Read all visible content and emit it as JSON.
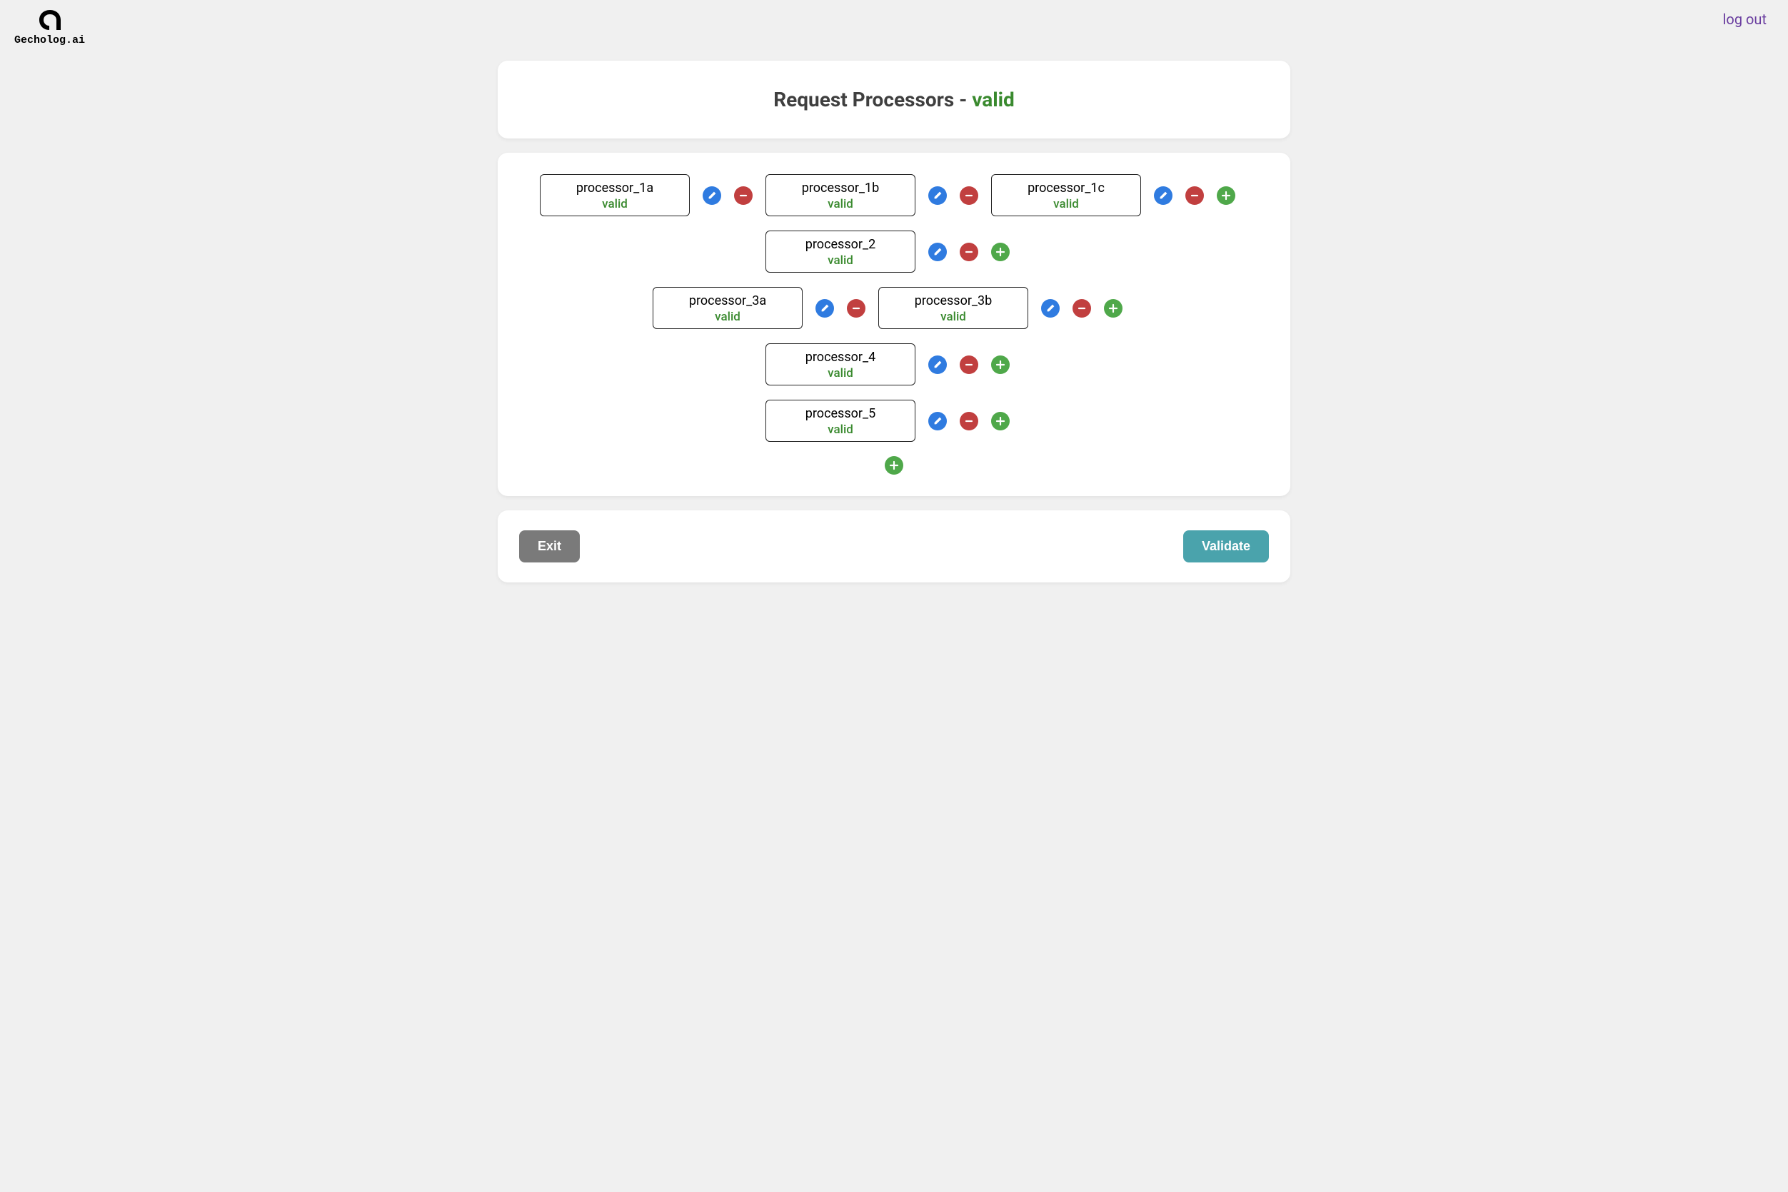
{
  "brand": "Gecholog.ai",
  "logout_label": "log out",
  "header": {
    "title": "Request Processors - ",
    "status": "valid"
  },
  "rows": [
    [
      {
        "name": "processor_1a",
        "status": "valid",
        "actions": [
          "edit",
          "remove"
        ]
      },
      {
        "name": "processor_1b",
        "status": "valid",
        "actions": [
          "edit",
          "remove"
        ]
      },
      {
        "name": "processor_1c",
        "status": "valid",
        "actions": [
          "edit",
          "remove",
          "add"
        ]
      }
    ],
    [
      {
        "name": "processor_2",
        "status": "valid",
        "actions": [
          "edit",
          "remove",
          "add"
        ]
      }
    ],
    [
      {
        "name": "processor_3a",
        "status": "valid",
        "actions": [
          "edit",
          "remove"
        ]
      },
      {
        "name": "processor_3b",
        "status": "valid",
        "actions": [
          "edit",
          "remove",
          "add"
        ]
      }
    ],
    [
      {
        "name": "processor_4",
        "status": "valid",
        "actions": [
          "edit",
          "remove",
          "add"
        ]
      }
    ],
    [
      {
        "name": "processor_5",
        "status": "valid",
        "actions": [
          "edit",
          "remove",
          "add"
        ]
      }
    ]
  ],
  "footer": {
    "exit_label": "Exit",
    "validate_label": "Validate"
  },
  "colors": {
    "valid": "#3a8a2f",
    "blue": "#2f7be0",
    "red": "#c13f3f",
    "green": "#4fa84a",
    "exit": "#7a7a7a",
    "validate": "#4aa3ac"
  }
}
